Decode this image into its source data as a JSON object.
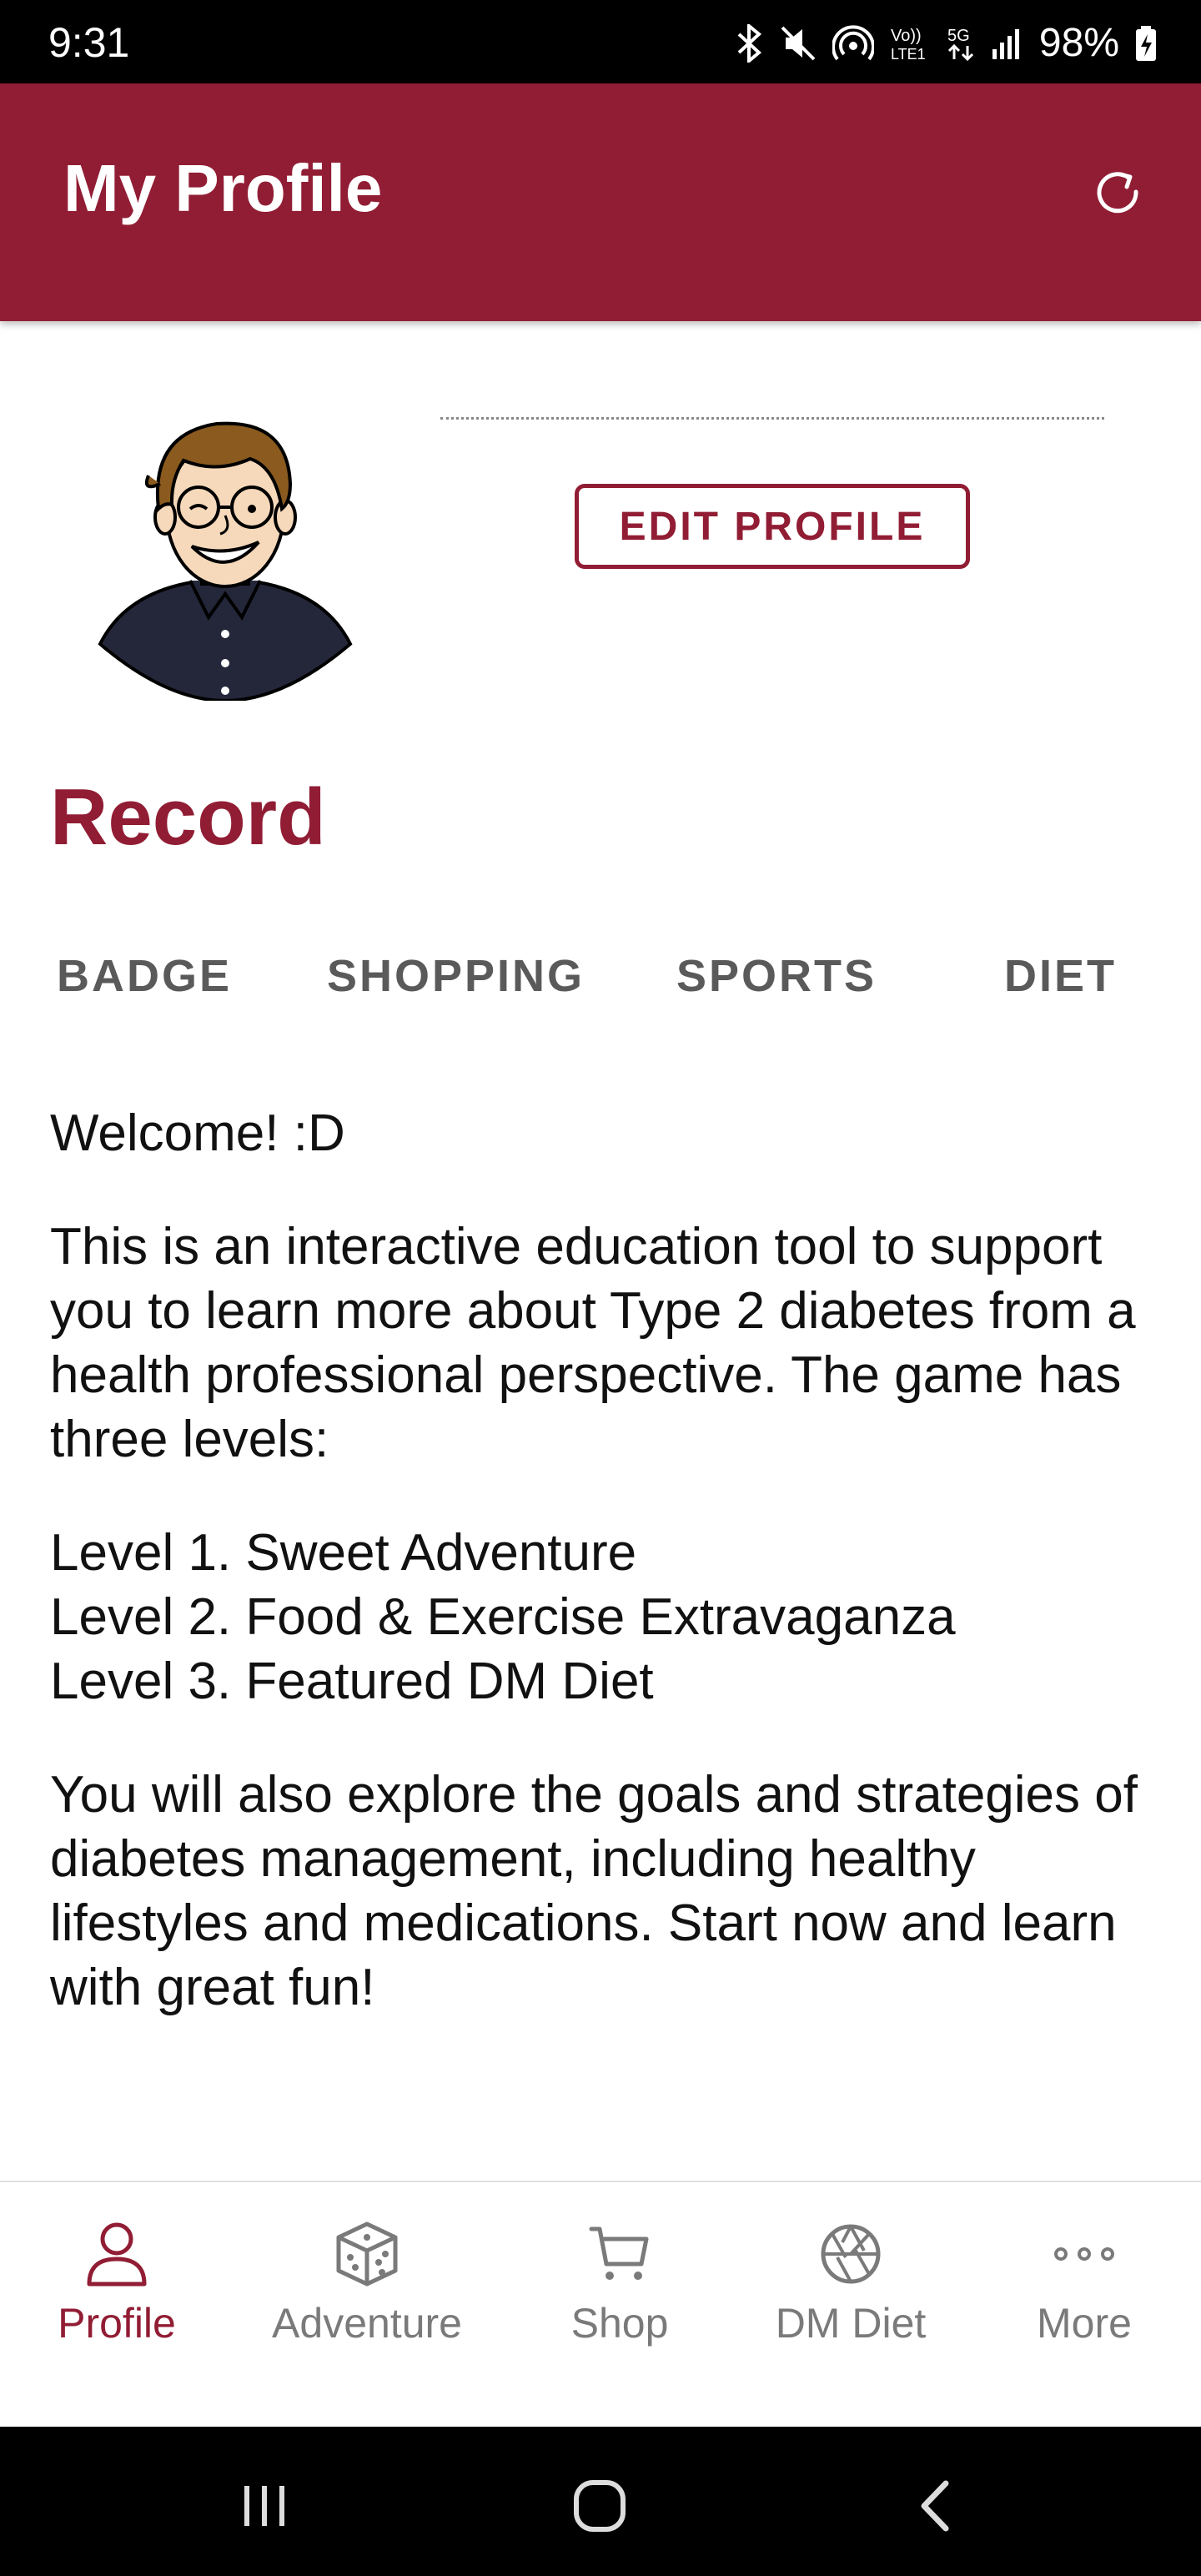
{
  "status_bar": {
    "time": "9:31",
    "battery": "98%",
    "icons": [
      "bluetooth-icon",
      "mute-icon",
      "hotspot-icon",
      "volte-icon",
      "5g-icon",
      "signal-icon",
      "battery-charging-icon"
    ]
  },
  "app_bar": {
    "title": "My Profile",
    "refresh_icon": "refresh-icon"
  },
  "profile": {
    "edit_button": "EDIT PROFILE"
  },
  "record": {
    "title": "Record",
    "tabs": [
      "BADGE",
      "SHOPPING",
      "SPORTS",
      "DIET"
    ]
  },
  "content": {
    "welcome": "Welcome! :D",
    "intro": "This is an interactive education tool to support you to learn more about Type 2 diabetes from a health professional perspective. The game has three levels:",
    "levels": [
      "Level 1. Sweet Adventure",
      "Level 2. Food & Exercise Extravaganza",
      "Level 3. Featured DM Diet"
    ],
    "outro": "You will also explore the goals and strategies of diabetes management, including healthy lifestyles and medications. Start now and learn with great fun!"
  },
  "bottom_nav": {
    "items": [
      {
        "label": "Profile",
        "icon": "person-icon",
        "active": true
      },
      {
        "label": "Adventure",
        "icon": "dice-icon",
        "active": false
      },
      {
        "label": "Shop",
        "icon": "cart-icon",
        "active": false
      },
      {
        "label": "DM Diet",
        "icon": "aperture-icon",
        "active": false
      },
      {
        "label": "More",
        "icon": "more-dots-icon",
        "active": false
      }
    ]
  },
  "colors": {
    "brand": "#911d34",
    "tab_text": "#5a5a5a",
    "nav_inactive": "#7a7a7a"
  }
}
